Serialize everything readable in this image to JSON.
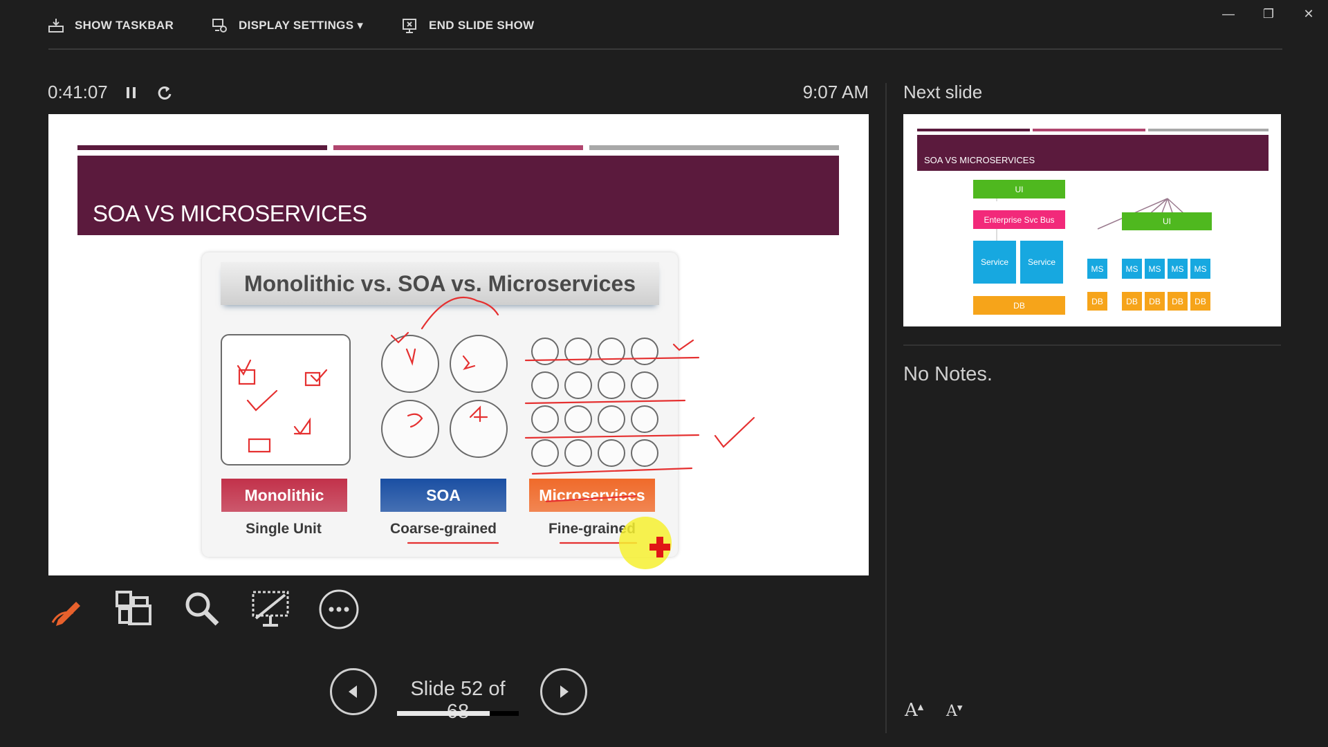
{
  "toolbar": {
    "show_taskbar": "SHOW TASKBAR",
    "display_settings": "DISPLAY SETTINGS ▾",
    "end_slide_show": "END SLIDE SHOW"
  },
  "presenter": {
    "elapsed_time": "0:41:07",
    "clock": "9:07 AM",
    "next_slide_label": "Next slide",
    "notes": "No Notes.",
    "slide_counter": "Slide 52 of 68",
    "progress_fraction": 0.76
  },
  "current_slide": {
    "title": "SOA VS MICROSERVICES",
    "diagram_title": "Monolithic vs. SOA vs. Microservices",
    "categories": [
      {
        "label": "Monolithic",
        "sublabel": "Single Unit",
        "color": "#c2314a"
      },
      {
        "label": "SOA",
        "sublabel": "Coarse-grained",
        "color": "#1a4fa3"
      },
      {
        "label": "Microservices",
        "sublabel": "Fine-grained",
        "color": "#f06a2a"
      }
    ],
    "bar_colors": [
      "#5b1a3d",
      "#b0456e",
      "#a8a8a8"
    ]
  },
  "next_slide": {
    "title": "SOA VS MICROSERVICES",
    "ui": "UI",
    "esb": "Enterprise Svc Bus",
    "service": "Service",
    "db": "DB",
    "ms": "MS"
  },
  "icons": [
    "taskbar-icon",
    "display-settings-icon",
    "end-show-icon",
    "minimize-icon",
    "restore-icon",
    "close-icon",
    "pause-icon",
    "restart-icon",
    "pen-icon",
    "all-slides-icon",
    "zoom-icon",
    "black-screen-icon",
    "more-options-icon",
    "previous-slide-icon",
    "next-slide-icon"
  ],
  "font_controls": {
    "increase": "A",
    "decrease": "A"
  }
}
